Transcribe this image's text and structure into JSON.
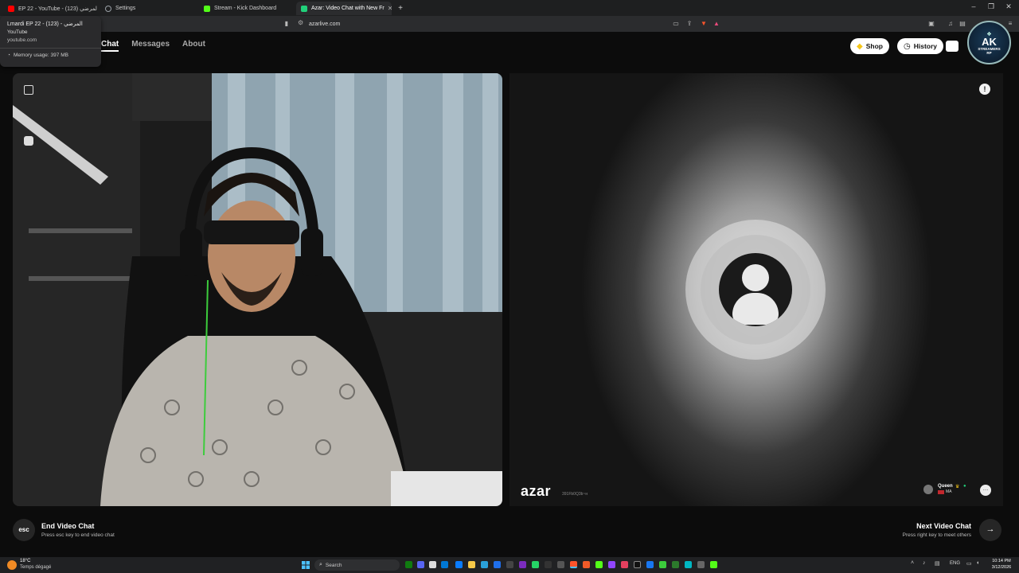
{
  "browser": {
    "tabs": [
      {
        "title": "EP 22 - YouTube - المرضي (123)",
        "favicon_color": "#ff0000",
        "active": false
      },
      {
        "title": "Settings",
        "favicon_color": "#9aa0a6",
        "active": false
      },
      {
        "title": "Stream - Kick Dashboard",
        "favicon_color": "#53fc18",
        "active": false
      },
      {
        "title": "Azar: Video Chat with New Fr",
        "favicon_color": "#21d07a",
        "active": true
      }
    ],
    "new_tab": "+",
    "url": "azarlive.com",
    "tooltip": {
      "title": "Lmardi EP 22 - المرضي - (123)",
      "site": "YouTube",
      "domain": "youtube.com",
      "memory": "Memory usage: 397 MB"
    }
  },
  "nav": {
    "chat": "Chat",
    "messages": "Messages",
    "about": "About"
  },
  "header_buttons": {
    "shop": "Shop",
    "history": "History"
  },
  "logo": {
    "line1": "AK",
    "line2": "STREAMERS",
    "line3": "RP"
  },
  "remote": {
    "brand": "azar",
    "session_id": "391Fb0Q3b~ʜ",
    "user_name": "Queen",
    "user_country": "MA"
  },
  "actions": {
    "end_key": "esc",
    "end_title": "End Video Chat",
    "end_hint": "Press esc key to end video chat",
    "next_title": "Next Video Chat",
    "next_hint": "Press right key to meet others"
  },
  "taskbar": {
    "weather_temp": "18°C",
    "weather_text": "Temps dégagé",
    "search": "Search",
    "lang": "ENG",
    "time": "10:14 PM",
    "date": "3/12/2026"
  },
  "colors": {
    "shop_diamond": "#f5c518",
    "kick_green": "#53fc18",
    "azar_green": "#21d07a"
  }
}
